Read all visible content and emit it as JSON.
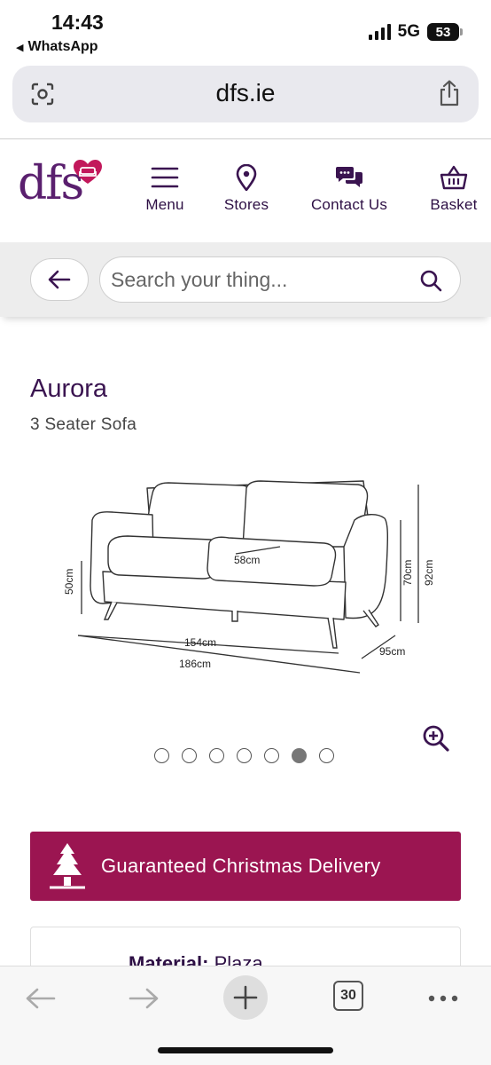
{
  "status_bar": {
    "time": "14:43",
    "back_app": "WhatsApp",
    "network": "5G",
    "battery": "53"
  },
  "browser": {
    "url": "dfs.ie",
    "tab_count": "30"
  },
  "site": {
    "logo": "dfs",
    "nav": [
      {
        "label": "Menu",
        "icon": "menu-icon"
      },
      {
        "label": "Stores",
        "icon": "location-pin-icon"
      },
      {
        "label": "Contact Us",
        "icon": "chat-icon"
      },
      {
        "label": "Basket",
        "icon": "basket-icon"
      }
    ],
    "search_placeholder": "Search your thing..."
  },
  "product": {
    "title": "Aurora",
    "subtitle": "3 Seater Sofa",
    "dimensions": {
      "seat_height": "50cm",
      "seat_depth": "58cm",
      "arm_height": "70cm",
      "total_height": "92cm",
      "inner_width": "154cm",
      "total_width": "186cm",
      "depth": "95cm"
    },
    "gallery_dots": 7,
    "gallery_active": 6
  },
  "banner": {
    "text": "Guaranteed Christmas Delivery"
  },
  "material": {
    "label": "Material:",
    "value": "Plaza"
  },
  "colors": {
    "brand_purple": "#3a1450",
    "banner_magenta": "#9b1551",
    "logo_heart": "#c2185b"
  }
}
